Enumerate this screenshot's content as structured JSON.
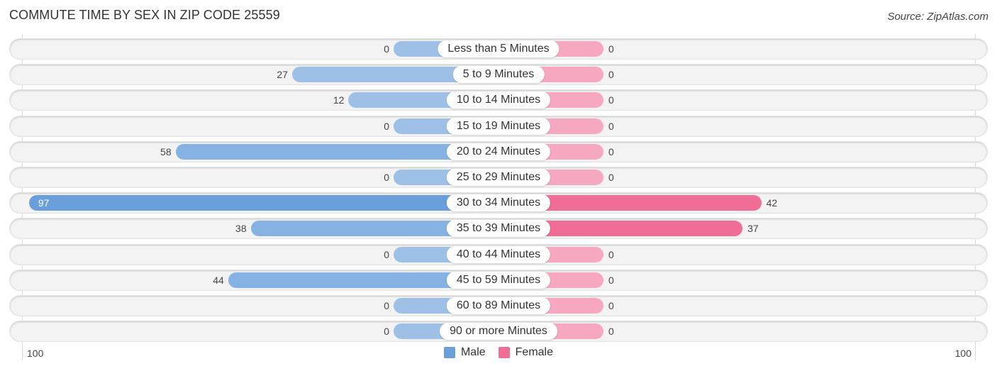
{
  "chart_data": {
    "type": "bar",
    "orientation": "horizontal-butterfly",
    "title": "COMMUTE TIME BY SEX IN ZIP CODE 25559",
    "source": "Source: ZipAtlas.com",
    "categories": [
      "Less than 5 Minutes",
      "5 to 9 Minutes",
      "10 to 14 Minutes",
      "15 to 19 Minutes",
      "20 to 24 Minutes",
      "25 to 29 Minutes",
      "30 to 34 Minutes",
      "35 to 39 Minutes",
      "40 to 44 Minutes",
      "45 to 59 Minutes",
      "60 to 89 Minutes",
      "90 or more Minutes"
    ],
    "series": [
      {
        "name": "Male",
        "color": "#6a9fdc",
        "values": [
          0,
          27,
          12,
          0,
          58,
          0,
          97,
          38,
          0,
          44,
          0,
          0
        ]
      },
      {
        "name": "Female",
        "color": "#f06d95",
        "values": [
          0,
          0,
          0,
          0,
          0,
          0,
          42,
          37,
          0,
          0,
          0,
          0
        ]
      }
    ],
    "axis": {
      "left_label": "100",
      "right_label": "100",
      "range": [
        0,
        100
      ]
    },
    "legend": {
      "position": "bottom-center",
      "items": [
        "Male",
        "Female"
      ]
    },
    "grid": false
  }
}
